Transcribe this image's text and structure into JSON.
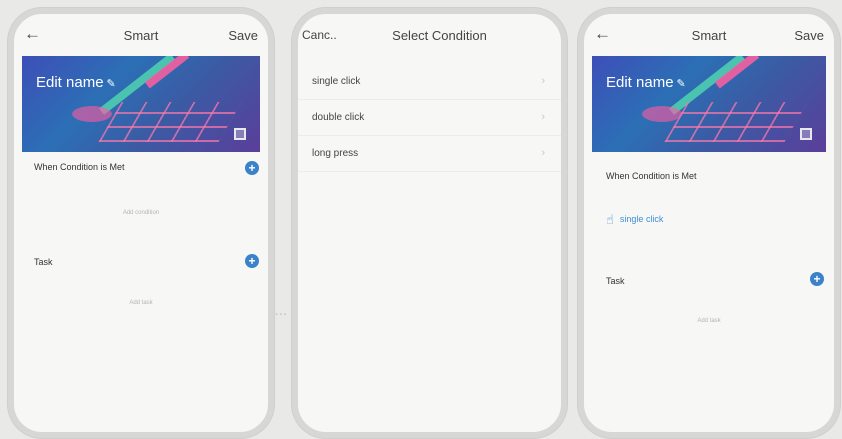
{
  "background_text": [
    "... ...... ......, ... ..... ..... ........ .. ........... .......",
    "..... ..... ... ... ... ... ... ........ ..... ...",
    "..... .... ... ..... ..... ..... ......"
  ],
  "screen1": {
    "title": "Smart",
    "save_label": "Save",
    "edit_name": "Edit name",
    "condition_title": "When Condition is Met",
    "condition_hint": "Add condition",
    "task_title": "Task",
    "task_hint": "Add task"
  },
  "screen2": {
    "cancel_label": "Canc..",
    "title": "Select Condition",
    "items": [
      "single click",
      "double click",
      "long press"
    ]
  },
  "screen3": {
    "title": "Smart",
    "save_label": "Save",
    "edit_name": "Edit name",
    "condition_title": "When Condition is Met",
    "selected_condition": "single click",
    "task_title": "Task",
    "task_hint": "Add task"
  },
  "colors": {
    "accent": "#3b82c9",
    "banner": "#3d4fb8"
  },
  "icons": [
    "back-arrow-icon",
    "pencil-icon",
    "image-icon",
    "plus-circle-icon",
    "chevron-right-icon",
    "tap-icon"
  ]
}
